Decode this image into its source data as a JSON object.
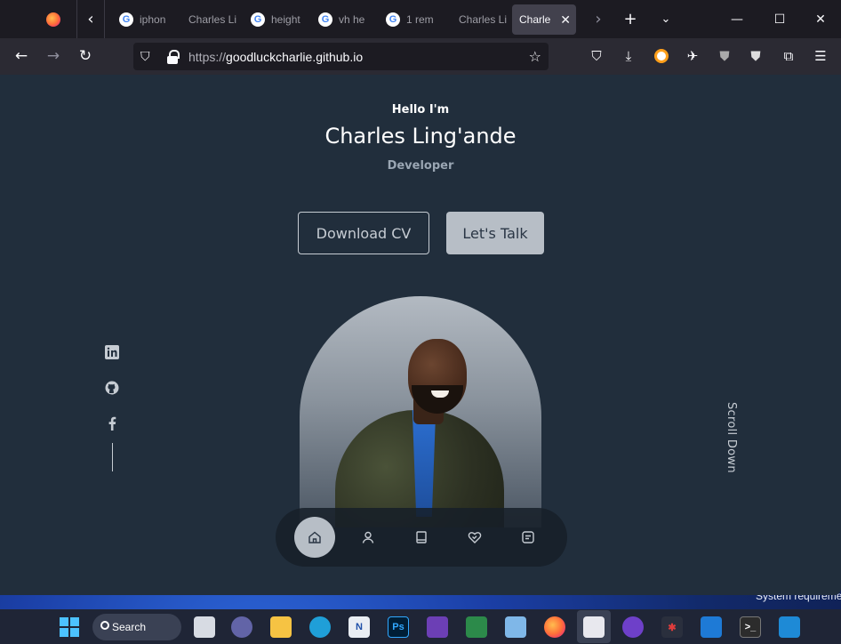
{
  "browser": {
    "tabs": [
      {
        "label": "iphon",
        "icon": "google-icon",
        "active": false
      },
      {
        "label": "Charles Li",
        "icon": "none",
        "active": false
      },
      {
        "label": "height",
        "icon": "google-icon",
        "active": false
      },
      {
        "label": "vh he",
        "icon": "google-icon",
        "active": false
      },
      {
        "label": "1 rem",
        "icon": "google-icon",
        "active": false
      },
      {
        "label": "Charles Li",
        "icon": "none",
        "active": false
      },
      {
        "label": "Charles",
        "icon": "none",
        "active": true
      }
    ],
    "url_protocol": "https://",
    "url_host": "goodluckcharlie.github.io"
  },
  "hero": {
    "greeting": "Hello I'm",
    "name": "Charles Ling'ande",
    "role": "Developer",
    "download_cv": "Download CV",
    "lets_talk": "Let's Talk",
    "scroll_down": "Scroll Down"
  },
  "socials": [
    "linkedin-icon",
    "github-icon",
    "facebook-icon"
  ],
  "dock": [
    "home-icon",
    "user-icon",
    "book-icon",
    "handshake-icon",
    "message-icon"
  ],
  "desktop": {
    "notification_text": "System requireme"
  },
  "taskbar": {
    "search_label": "Search"
  }
}
